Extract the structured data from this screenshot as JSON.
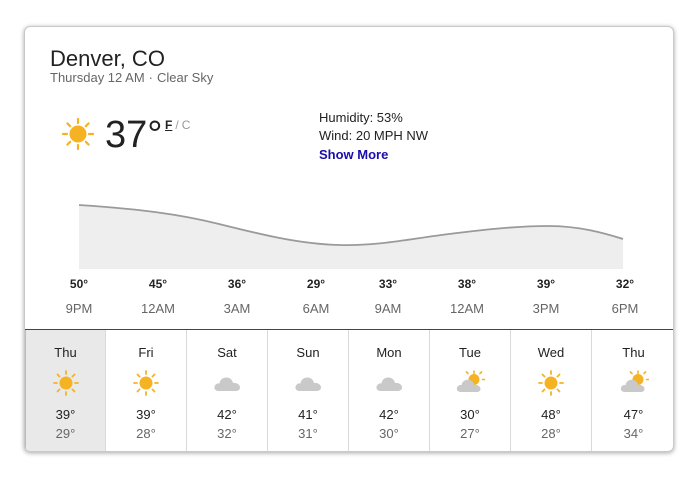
{
  "location": "Denver, CO",
  "time": "Thursday 12 AM",
  "condition": "Clear Sky",
  "current": {
    "temp": "37°",
    "unit_f": "F",
    "unit_c": "C",
    "icon": "sun-icon",
    "humidity": "Humidity: 53%",
    "wind": "Wind: 20 MPH NW",
    "show_more": "Show More"
  },
  "hourly": [
    {
      "temp": "50°",
      "time": "9PM"
    },
    {
      "temp": "45°",
      "time": "12AM"
    },
    {
      "temp": "36°",
      "time": "3AM"
    },
    {
      "temp": "29°",
      "time": "6AM"
    },
    {
      "temp": "33°",
      "time": "9AM"
    },
    {
      "temp": "38°",
      "time": "12AM"
    },
    {
      "temp": "39°",
      "time": "3PM"
    },
    {
      "temp": "32°",
      "time": "6PM"
    }
  ],
  "daily": [
    {
      "day": "Thu",
      "icon": "sun-icon",
      "high": "39°",
      "low": "29°",
      "selected": true
    },
    {
      "day": "Fri",
      "icon": "sun-icon",
      "high": "39°",
      "low": "28°"
    },
    {
      "day": "Sat",
      "icon": "cloud-icon",
      "high": "42°",
      "low": "32°"
    },
    {
      "day": "Sun",
      "icon": "cloud-icon",
      "high": "41°",
      "low": "31°"
    },
    {
      "day": "Mon",
      "icon": "cloud-icon",
      "high": "42°",
      "low": "30°"
    },
    {
      "day": "Tue",
      "icon": "partly-cloudy-icon",
      "high": "30°",
      "low": "27°"
    },
    {
      "day": "Wed",
      "icon": "sun-icon",
      "high": "48°",
      "low": "28°"
    },
    {
      "day": "Thu",
      "icon": "partly-cloudy-icon",
      "high": "47°",
      "low": "34°"
    }
  ],
  "colors": {
    "sun": "#f5b324",
    "cloud": "#c9c9c9",
    "link": "#1a0dab",
    "graph_fill": "#eeeeee",
    "graph_line": "#9a9a9a"
  }
}
